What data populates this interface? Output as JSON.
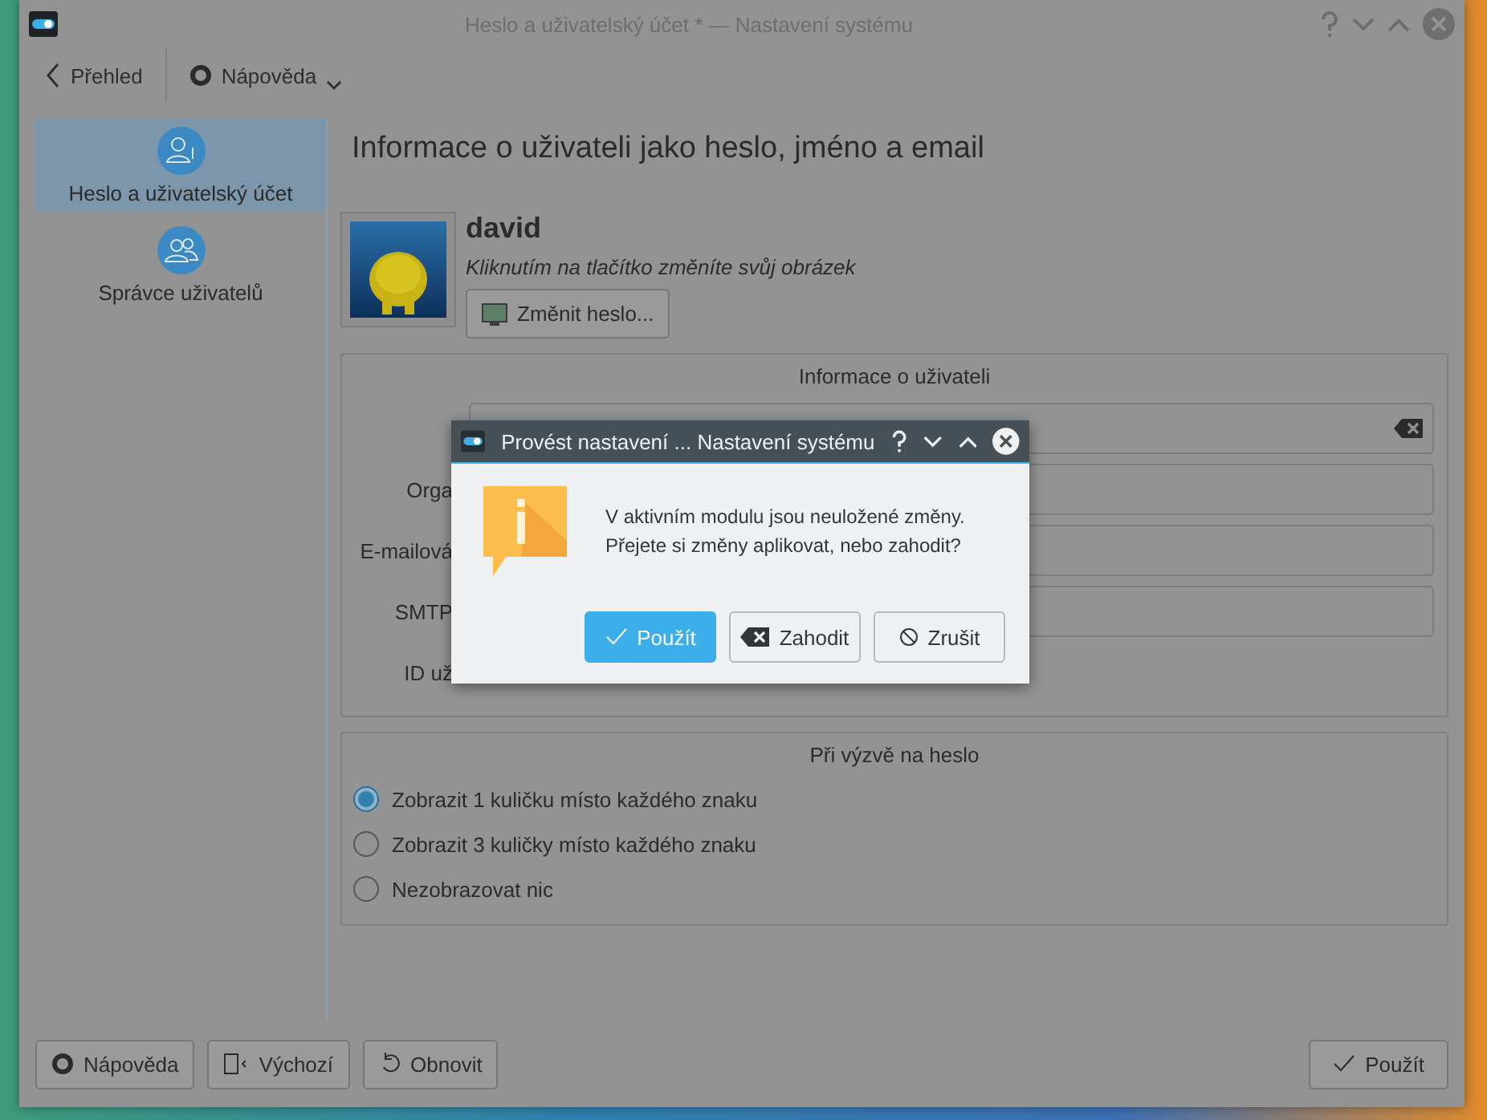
{
  "window": {
    "title": "Heslo a uživatelský účet * — Nastavení systému"
  },
  "toolbar": {
    "back": "Přehled",
    "help": "Nápověda"
  },
  "sidebar": {
    "items": [
      {
        "label": "Heslo a uživatelský účet",
        "kind": "account",
        "selected": true
      },
      {
        "label": "Správce uživatelů",
        "kind": "users",
        "selected": false
      }
    ]
  },
  "page": {
    "heading": "Informace o uživateli jako heslo, jméno a email",
    "user_name": "david",
    "avatar_hint": "Kliknutím na tlačítko změníte svůj obrázek",
    "change_password": "Změnit heslo..."
  },
  "user_info": {
    "title": "Informace o uživateli",
    "rows": [
      {
        "kind": "field",
        "clearable": true
      },
      {
        "label": "Orga",
        "kind": "field",
        "clearable": false
      },
      {
        "label": "E-mailová",
        "kind": "field",
        "clearable": false
      },
      {
        "label": "SMTP",
        "kind": "field",
        "clearable": false
      },
      {
        "label": "ID už",
        "kind": "text"
      }
    ]
  },
  "password_prompt": {
    "title": "Při výzvě na heslo",
    "options": [
      {
        "label": "Zobrazit 1 kuličku místo každého znaku",
        "selected": true
      },
      {
        "label": "Zobrazit 3 kuličky místo každého znaku",
        "selected": false
      },
      {
        "label": "Nezobrazovat nic",
        "selected": false
      }
    ]
  },
  "footer": {
    "left": [
      {
        "label": "Nápověda",
        "kind": "help"
      },
      {
        "label": "Výchozí",
        "kind": "defaults"
      },
      {
        "label": "Obnovit",
        "kind": "reset"
      }
    ],
    "right": [
      {
        "label": "Použít",
        "kind": "apply"
      }
    ]
  },
  "dialog": {
    "title": "Provést nastavení ... Nastavení systému",
    "message": [
      "V aktivním modulu jsou neuložené změny.",
      "Přejete si změny aplikovat, nebo zahodit?"
    ],
    "buttons": [
      {
        "label": "Použít",
        "kind": "apply",
        "primary": true
      },
      {
        "label": "Zahodit",
        "kind": "discard",
        "primary": false
      },
      {
        "label": "Zrušit",
        "kind": "cancel",
        "primary": false
      }
    ]
  }
}
